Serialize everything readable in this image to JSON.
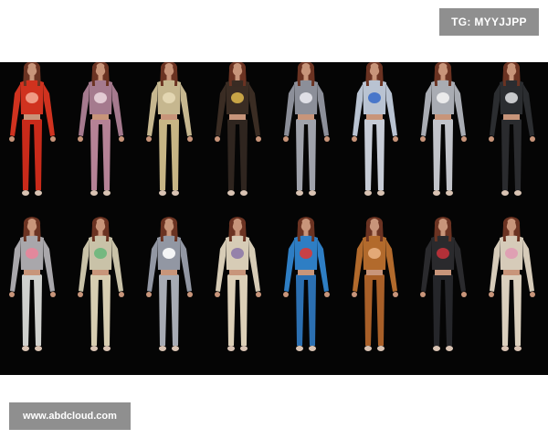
{
  "telegram_tag": "TG: MYYJJPP",
  "watermark": "www.abdcloud.com",
  "outfits": [
    {
      "top": "#d0321f",
      "pants": "#c92a1a",
      "print": "#f2a58f"
    },
    {
      "top": "#a57a8e",
      "pants": "#b58296",
      "print": "#e9d3da"
    },
    {
      "top": "#c6b78f",
      "pants": "#c7b585",
      "print": "#e5d9b6"
    },
    {
      "top": "#3a2c23",
      "pants": "#2f251f",
      "print": "#d8b14a"
    },
    {
      "top": "#8c8f99",
      "pants": "#9fa2ab",
      "print": "#e8e8ee"
    },
    {
      "top": "#b9c3d2",
      "pants": "#c7ccd6",
      "print": "#3d6fc9"
    },
    {
      "top": "#a9acb3",
      "pants": "#c2c4ca",
      "print": "#f1f1f1"
    },
    {
      "top": "#2b2d30",
      "pants": "#2a2b2e",
      "print": "#d9dadd"
    },
    {
      "top": "#a9a7ab",
      "pants": "#cfd0cd",
      "print": "#e8859a"
    },
    {
      "top": "#c9c2a8",
      "pants": "#d7cdb1",
      "print": "#6ab77b"
    },
    {
      "top": "#9297a3",
      "pants": "#a7abb4",
      "print": "#ffffff"
    },
    {
      "top": "#d7ccb6",
      "pants": "#dccfb7",
      "print": "#8e7aa8"
    },
    {
      "top": "#2e7ec4",
      "pants": "#2b6fb1",
      "print": "#d93b38"
    },
    {
      "top": "#b26a2c",
      "pants": "#a85f28",
      "print": "#e8b080"
    },
    {
      "top": "#2a2a2d",
      "pants": "#25262a",
      "print": "#c2313a"
    },
    {
      "top": "#d6cbb9",
      "pants": "#dacfbd",
      "print": "#e09bb2"
    }
  ]
}
